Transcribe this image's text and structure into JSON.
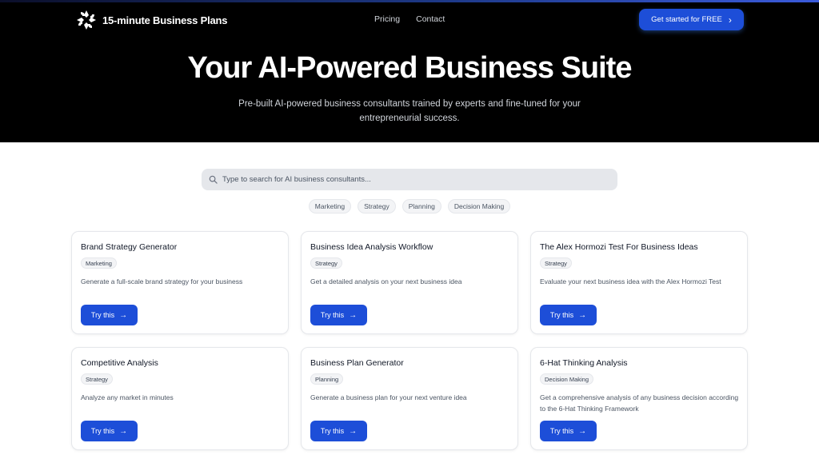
{
  "brand": {
    "name": "15-minute Business Plans",
    "logo_icon": "swirl-diamond-logo-icon"
  },
  "nav": {
    "items": [
      {
        "label": "Pricing"
      },
      {
        "label": "Contact"
      }
    ]
  },
  "cta": {
    "label": "Get started for FREE",
    "icon": "chevron-right-icon"
  },
  "hero": {
    "title": "Your AI-Powered Business Suite",
    "subtitle": "Pre-built AI-powered business consultants trained by experts and fine-tuned for your entrepreneurial success."
  },
  "search": {
    "placeholder": "Type to search for AI business consultants...",
    "value": "",
    "icon": "search-icon"
  },
  "filters": [
    {
      "label": "Marketing"
    },
    {
      "label": "Strategy"
    },
    {
      "label": "Planning"
    },
    {
      "label": "Decision Making"
    }
  ],
  "cards": [
    {
      "title": "Brand Strategy Generator",
      "tag": "Marketing",
      "description": "Generate a full-scale brand strategy for your business",
      "button": "Try this"
    },
    {
      "title": "Business Idea Analysis Workflow",
      "tag": "Strategy",
      "description": "Get a detailed analysis on your next business idea",
      "button": "Try this"
    },
    {
      "title": "The Alex Hormozi Test For Business Ideas",
      "tag": "Strategy",
      "description": "Evaluate your next business idea with the Alex Hormozi Test",
      "button": "Try this"
    },
    {
      "title": "Competitive Analysis",
      "tag": "Strategy",
      "description": "Analyze any market in minutes",
      "button": "Try this"
    },
    {
      "title": "Business Plan Generator",
      "tag": "Planning",
      "description": "Generate a business plan for your next venture idea",
      "button": "Try this"
    },
    {
      "title": "6-Hat Thinking Analysis",
      "tag": "Decision Making",
      "description": "Get a comprehensive analysis of any business decision according to the 6-Hat Thinking Framework",
      "button": "Try this"
    }
  ],
  "colors": {
    "hero_bg": "#000000",
    "accent": "#1d4ed8",
    "chip_bg": "#f3f4f6",
    "search_bg": "#e5e7eb"
  }
}
